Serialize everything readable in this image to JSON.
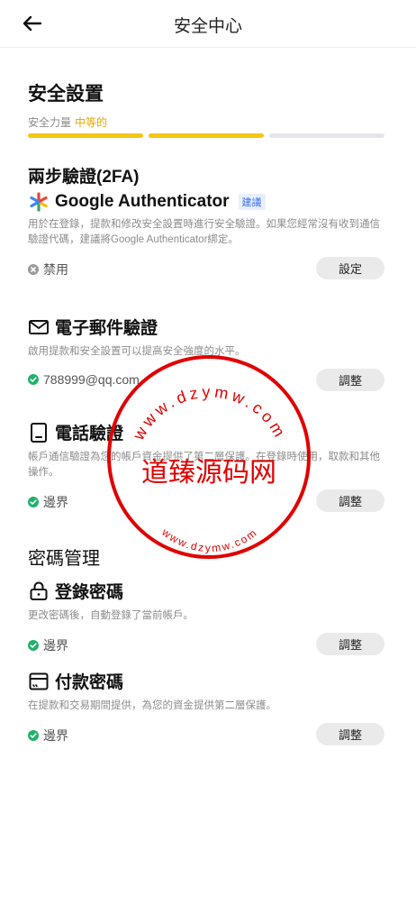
{
  "header": {
    "title": "安全中心",
    "back_icon": "arrow-left-icon"
  },
  "page": {
    "heading": "安全設置",
    "strength_label": "安全力量",
    "strength_value": "中等的",
    "strength_level": "2/3",
    "colors": {
      "strength_on": "#f5c518",
      "strength_off": "#e6e6ea",
      "ok": "#20b26b",
      "recommend": "#3a6df0"
    }
  },
  "twofa": {
    "section_title": "兩步驗證(2FA)",
    "google": {
      "title": "Google Authenticator",
      "badge": "建議",
      "desc": "用於在登錄，提款和修改安全設置時進行安全驗證。如果您經常沒有收到通信驗證代碼，建議將Google Authenticator綁定。",
      "status": "禁用",
      "button": "設定"
    },
    "email": {
      "title": "電子郵件驗證",
      "desc": "啟用提款和安全設置可以提高安全強度的水平。",
      "status": "788999@qq.com",
      "button": "調整"
    },
    "phone": {
      "title": "電話驗證",
      "desc": "帳戶通信驗證為您的帳戶資金提供了第二層保護。在登錄時使用，取款和其他操作。",
      "status": "邊界",
      "button": "調整"
    }
  },
  "password": {
    "section_title": "密碼管理",
    "login": {
      "title": "登錄密碼",
      "desc": "更改密碼後，自動登錄了當前帳戶。",
      "status": "邊界",
      "button": "調整"
    },
    "payment": {
      "title": "付款密碼",
      "desc": "在提款和交易期間提供，為您的資金提供第二層保護。",
      "status": "邊界",
      "button": "調整"
    }
  },
  "watermark": {
    "main": "道臻源码网",
    "ring_top": "www.dzymw.com",
    "ring_bottom": "www.dzymw.com"
  }
}
